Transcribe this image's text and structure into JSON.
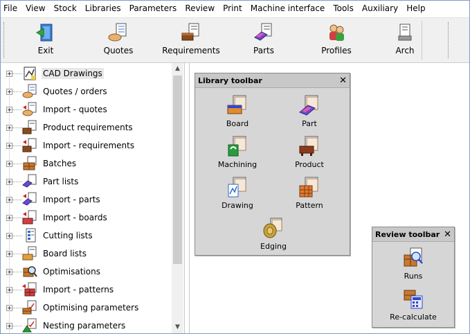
{
  "menu": [
    "File",
    "View",
    "Stock",
    "Libraries",
    "Parameters",
    "Review",
    "Print",
    "Machine interface",
    "Tools",
    "Auxiliary",
    "Help"
  ],
  "toolbar": {
    "buttons": [
      {
        "label": "Exit",
        "icon": "exit-door-icon"
      },
      {
        "label": "Quotes",
        "icon": "quotes-handshake-icon"
      },
      {
        "label": "Requirements",
        "icon": "requirements-icon"
      },
      {
        "label": "Parts",
        "icon": "parts-icon"
      },
      {
        "label": "Profiles",
        "icon": "profiles-people-icon"
      },
      {
        "label": "Arch",
        "icon": "archive-icon"
      }
    ]
  },
  "tree": {
    "items": [
      {
        "label": "CAD Drawings",
        "icon": "cad-drawing-icon",
        "selected": true
      },
      {
        "label": "Quotes / orders",
        "icon": "quotes-icon"
      },
      {
        "label": "Import - quotes",
        "icon": "import-quotes-icon"
      },
      {
        "label": "Product requirements",
        "icon": "product-requirements-icon"
      },
      {
        "label": "Import - requirements",
        "icon": "import-requirements-icon"
      },
      {
        "label": "Batches",
        "icon": "batches-icon"
      },
      {
        "label": "Part lists",
        "icon": "part-lists-icon"
      },
      {
        "label": "Import - parts",
        "icon": "import-parts-icon"
      },
      {
        "label": "Import - boards",
        "icon": "import-boards-icon"
      },
      {
        "label": "Cutting lists",
        "icon": "cutting-lists-icon"
      },
      {
        "label": "Board lists",
        "icon": "board-lists-icon"
      },
      {
        "label": "Optimisations",
        "icon": "optimisations-icon"
      },
      {
        "label": "Import - patterns",
        "icon": "import-patterns-icon"
      },
      {
        "label": "Optimising parameters",
        "icon": "optimising-parameters-icon"
      },
      {
        "label": "Nesting parameters",
        "icon": "nesting-parameters-icon"
      }
    ]
  },
  "library_toolbar": {
    "title": "Library toolbar",
    "close": "✕",
    "buttons": [
      {
        "label": "Board",
        "icon": "board-library-icon"
      },
      {
        "label": "Part",
        "icon": "part-library-icon"
      },
      {
        "label": "Machining",
        "icon": "machining-library-icon"
      },
      {
        "label": "Product",
        "icon": "product-library-icon"
      },
      {
        "label": "Drawing",
        "icon": "drawing-library-icon"
      },
      {
        "label": "Pattern",
        "icon": "pattern-library-icon"
      },
      {
        "label": "Edging",
        "icon": "edging-library-icon"
      }
    ]
  },
  "review_toolbar": {
    "title": "Review toolbar",
    "close": "✕",
    "buttons": [
      {
        "label": "Runs",
        "icon": "runs-icon"
      },
      {
        "label": "Re-calculate",
        "icon": "recalculate-icon"
      }
    ]
  },
  "scroll_up": "▲",
  "scroll_down": "▼"
}
